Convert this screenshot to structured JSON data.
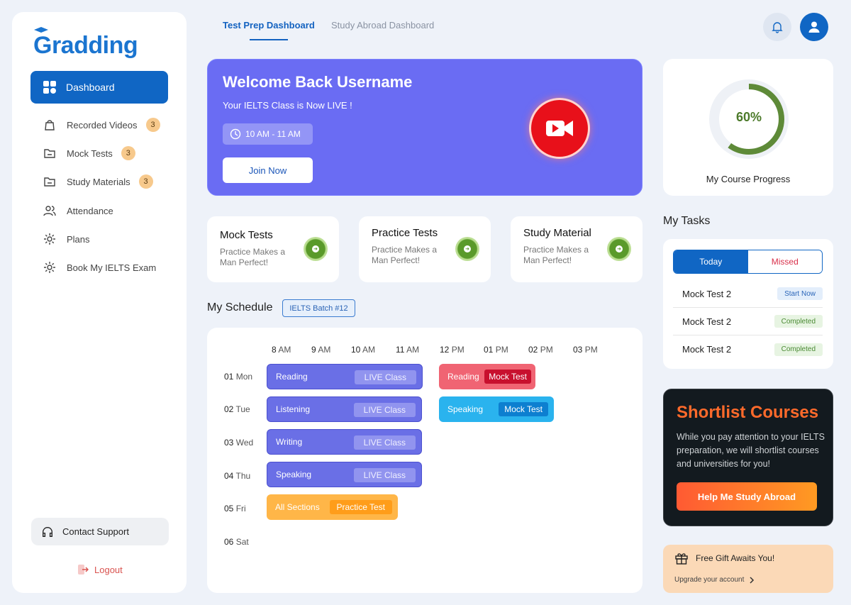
{
  "brand": {
    "logo_text": "Gradding"
  },
  "sidebar": {
    "items": [
      {
        "label": "Dashboard"
      },
      {
        "label": "Recorded Videos",
        "badge": "3"
      },
      {
        "label": "Mock Tests",
        "badge": "3"
      },
      {
        "label": "Study Materials",
        "badge": "3"
      },
      {
        "label": "Attendance"
      },
      {
        "label": "Plans"
      },
      {
        "label": "Book My IELTS Exam"
      }
    ],
    "contact_support": "Contact Support",
    "logout": "Logout"
  },
  "header": {
    "tabs": [
      {
        "label": "Test Prep Dashboard",
        "active": true
      },
      {
        "label": "Study Abroad Dashboard",
        "active": false
      }
    ]
  },
  "welcome": {
    "title": "Welcome Back Username",
    "subtitle": "Your IELTS Class is Now LIVE !",
    "time": "10 AM - 11 AM",
    "join_label": "Join Now"
  },
  "cards": [
    {
      "title": "Mock Tests",
      "desc": "Practice Makes a Man Perfect!"
    },
    {
      "title": "Practice Tests",
      "desc": "Practice Makes a Man Perfect!"
    },
    {
      "title": "Study Material",
      "desc": "Practice Makes a Man Perfect!"
    }
  ],
  "schedule": {
    "title": "My Schedule",
    "batch": "IELTS Batch #12",
    "hours": [
      {
        "n": "8",
        "p": "AM"
      },
      {
        "n": "9",
        "p": "AM"
      },
      {
        "n": "10",
        "p": "AM"
      },
      {
        "n": "11",
        "p": "AM"
      },
      {
        "n": "12",
        "p": "PM"
      },
      {
        "n": "01",
        "p": "PM"
      },
      {
        "n": "02",
        "p": "PM"
      },
      {
        "n": "03",
        "p": "PM"
      }
    ],
    "days": [
      {
        "n": "01",
        "d": "Mon"
      },
      {
        "n": "02",
        "d": "Tue"
      },
      {
        "n": "03",
        "d": "Wed"
      },
      {
        "n": "04",
        "d": "Thu"
      },
      {
        "n": "05",
        "d": "Fri"
      },
      {
        "n": "06",
        "d": "Sat"
      }
    ],
    "events": [
      {
        "subject": "Reading",
        "tag": "LIVE Class"
      },
      {
        "subject": "Reading",
        "tag": "Mock Test"
      },
      {
        "subject": "Listening",
        "tag": "LIVE Class"
      },
      {
        "subject": "Speaking",
        "tag": "Mock Test"
      },
      {
        "subject": "Writing",
        "tag": "LIVE Class"
      },
      {
        "subject": "Speaking",
        "tag": "LIVE Class"
      },
      {
        "subject": "All Sections",
        "tag": "Practice Test"
      }
    ]
  },
  "progress": {
    "percent_label": "60%",
    "value": 0.6,
    "label": "My Course Progress",
    "color": "#5e8a38"
  },
  "tasks": {
    "title": "My Tasks",
    "segments": [
      "Today",
      "Missed"
    ],
    "rows": [
      {
        "name": "Mock Test 2",
        "status": "Start Now"
      },
      {
        "name": "Mock Test 2",
        "status": "Completed"
      },
      {
        "name": "Mock Test 2",
        "status": "Completed"
      }
    ]
  },
  "shortlist": {
    "title": "Shortlist Courses",
    "body": "While you pay attention to your IELTS preparation, we will shortlist courses and universities for you!",
    "cta": "Help Me Study Abroad"
  },
  "gift": {
    "title": "Free Gift Awaits You!",
    "link": "Upgrade your account"
  },
  "colors": {
    "primary": "#1066c4",
    "banner": "#6a6cf3",
    "live_red": "#e8101a",
    "accent_orange": "#ff6a2b"
  }
}
